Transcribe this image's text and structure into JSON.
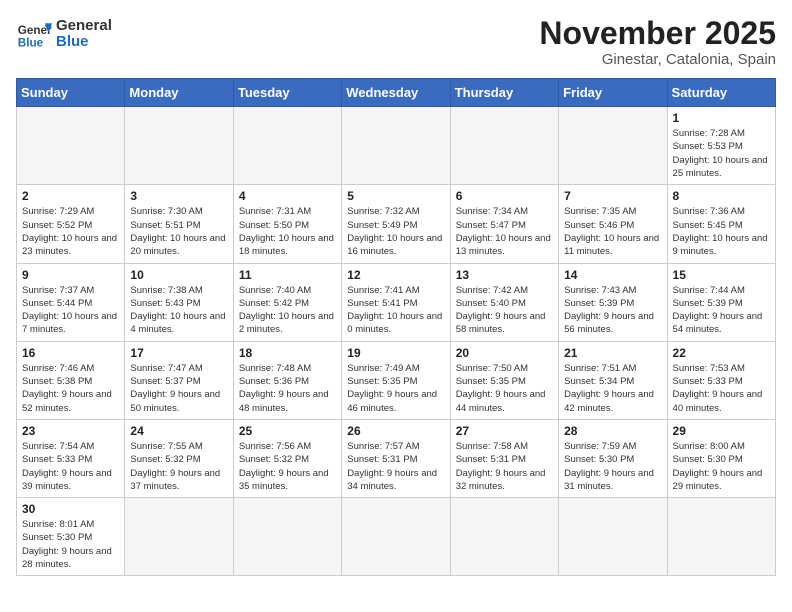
{
  "header": {
    "logo_text_general": "General",
    "logo_text_blue": "Blue",
    "month_title": "November 2025",
    "subtitle": "Ginestar, Catalonia, Spain"
  },
  "weekdays": [
    "Sunday",
    "Monday",
    "Tuesday",
    "Wednesday",
    "Thursday",
    "Friday",
    "Saturday"
  ],
  "days": [
    {
      "date": "",
      "info": ""
    },
    {
      "date": "",
      "info": ""
    },
    {
      "date": "",
      "info": ""
    },
    {
      "date": "",
      "info": ""
    },
    {
      "date": "",
      "info": ""
    },
    {
      "date": "",
      "info": ""
    },
    {
      "date": "1",
      "info": "Sunrise: 7:28 AM\nSunset: 5:53 PM\nDaylight: 10 hours\nand 25 minutes."
    },
    {
      "date": "2",
      "info": "Sunrise: 7:29 AM\nSunset: 5:52 PM\nDaylight: 10 hours\nand 23 minutes."
    },
    {
      "date": "3",
      "info": "Sunrise: 7:30 AM\nSunset: 5:51 PM\nDaylight: 10 hours\nand 20 minutes."
    },
    {
      "date": "4",
      "info": "Sunrise: 7:31 AM\nSunset: 5:50 PM\nDaylight: 10 hours\nand 18 minutes."
    },
    {
      "date": "5",
      "info": "Sunrise: 7:32 AM\nSunset: 5:49 PM\nDaylight: 10 hours\nand 16 minutes."
    },
    {
      "date": "6",
      "info": "Sunrise: 7:34 AM\nSunset: 5:47 PM\nDaylight: 10 hours\nand 13 minutes."
    },
    {
      "date": "7",
      "info": "Sunrise: 7:35 AM\nSunset: 5:46 PM\nDaylight: 10 hours\nand 11 minutes."
    },
    {
      "date": "8",
      "info": "Sunrise: 7:36 AM\nSunset: 5:45 PM\nDaylight: 10 hours\nand 9 minutes."
    },
    {
      "date": "9",
      "info": "Sunrise: 7:37 AM\nSunset: 5:44 PM\nDaylight: 10 hours\nand 7 minutes."
    },
    {
      "date": "10",
      "info": "Sunrise: 7:38 AM\nSunset: 5:43 PM\nDaylight: 10 hours\nand 4 minutes."
    },
    {
      "date": "11",
      "info": "Sunrise: 7:40 AM\nSunset: 5:42 PM\nDaylight: 10 hours\nand 2 minutes."
    },
    {
      "date": "12",
      "info": "Sunrise: 7:41 AM\nSunset: 5:41 PM\nDaylight: 10 hours\nand 0 minutes."
    },
    {
      "date": "13",
      "info": "Sunrise: 7:42 AM\nSunset: 5:40 PM\nDaylight: 9 hours\nand 58 minutes."
    },
    {
      "date": "14",
      "info": "Sunrise: 7:43 AM\nSunset: 5:39 PM\nDaylight: 9 hours\nand 56 minutes."
    },
    {
      "date": "15",
      "info": "Sunrise: 7:44 AM\nSunset: 5:39 PM\nDaylight: 9 hours\nand 54 minutes."
    },
    {
      "date": "16",
      "info": "Sunrise: 7:46 AM\nSunset: 5:38 PM\nDaylight: 9 hours\nand 52 minutes."
    },
    {
      "date": "17",
      "info": "Sunrise: 7:47 AM\nSunset: 5:37 PM\nDaylight: 9 hours\nand 50 minutes."
    },
    {
      "date": "18",
      "info": "Sunrise: 7:48 AM\nSunset: 5:36 PM\nDaylight: 9 hours\nand 48 minutes."
    },
    {
      "date": "19",
      "info": "Sunrise: 7:49 AM\nSunset: 5:35 PM\nDaylight: 9 hours\nand 46 minutes."
    },
    {
      "date": "20",
      "info": "Sunrise: 7:50 AM\nSunset: 5:35 PM\nDaylight: 9 hours\nand 44 minutes."
    },
    {
      "date": "21",
      "info": "Sunrise: 7:51 AM\nSunset: 5:34 PM\nDaylight: 9 hours\nand 42 minutes."
    },
    {
      "date": "22",
      "info": "Sunrise: 7:53 AM\nSunset: 5:33 PM\nDaylight: 9 hours\nand 40 minutes."
    },
    {
      "date": "23",
      "info": "Sunrise: 7:54 AM\nSunset: 5:33 PM\nDaylight: 9 hours\nand 39 minutes."
    },
    {
      "date": "24",
      "info": "Sunrise: 7:55 AM\nSunset: 5:32 PM\nDaylight: 9 hours\nand 37 minutes."
    },
    {
      "date": "25",
      "info": "Sunrise: 7:56 AM\nSunset: 5:32 PM\nDaylight: 9 hours\nand 35 minutes."
    },
    {
      "date": "26",
      "info": "Sunrise: 7:57 AM\nSunset: 5:31 PM\nDaylight: 9 hours\nand 34 minutes."
    },
    {
      "date": "27",
      "info": "Sunrise: 7:58 AM\nSunset: 5:31 PM\nDaylight: 9 hours\nand 32 minutes."
    },
    {
      "date": "28",
      "info": "Sunrise: 7:59 AM\nSunset: 5:30 PM\nDaylight: 9 hours\nand 31 minutes."
    },
    {
      "date": "29",
      "info": "Sunrise: 8:00 AM\nSunset: 5:30 PM\nDaylight: 9 hours\nand 29 minutes."
    },
    {
      "date": "30",
      "info": "Sunrise: 8:01 AM\nSunset: 5:30 PM\nDaylight: 9 hours\nand 28 minutes."
    },
    {
      "date": "",
      "info": ""
    },
    {
      "date": "",
      "info": ""
    },
    {
      "date": "",
      "info": ""
    },
    {
      "date": "",
      "info": ""
    },
    {
      "date": "",
      "info": ""
    },
    {
      "date": "",
      "info": ""
    }
  ]
}
